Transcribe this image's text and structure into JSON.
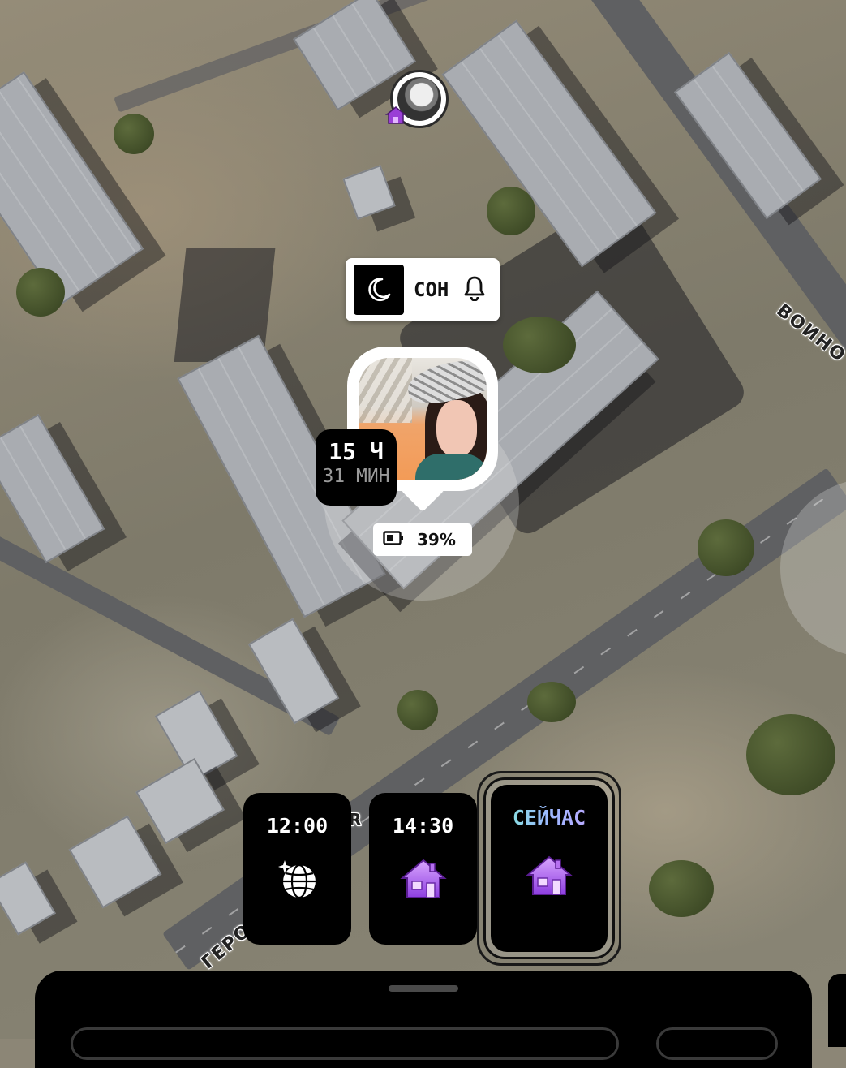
{
  "map": {
    "street_labels": [
      "ВОИНО",
      "ГЕРО"
    ],
    "timeline_r_glyph": "R"
  },
  "mini_marker": {
    "badge_icon": "house-icon"
  },
  "status": {
    "label": "СОН",
    "icon_left": "moon-icon",
    "icon_right": "bell-icon"
  },
  "avatar": {
    "duration_hours": "15 Ч",
    "duration_minutes": "31 МИН"
  },
  "battery": {
    "percent": "39%",
    "icon": "battery-icon"
  },
  "timeline": [
    {
      "time": "12:00",
      "icon": "globe-sparkle-icon"
    },
    {
      "time": "14:30",
      "icon": "house-icon"
    },
    {
      "time": "СЕЙЧАС",
      "icon": "house-icon",
      "current": true
    }
  ],
  "colors": {
    "now_gradient": [
      "#7ff0d2",
      "#9bb8ff",
      "#c9a3ff"
    ],
    "house_purple": "#b36bff"
  }
}
